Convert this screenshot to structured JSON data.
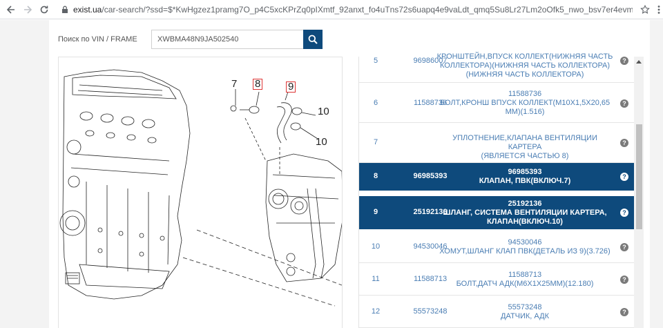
{
  "browser": {
    "url_host": "exist.ua",
    "url_path": "/car-search/?ssd=$*KwHgzez1pramg7O_p4C5xcKPrZq0pIXmtf_92anxt_fo4uTns72s6uapq4e9vaLdt_qmq5Su8Lr27Lm2oOfk5_nwo_bsv7er4evm7eH_9qKpv7uB8amr..."
  },
  "search": {
    "label": "Поиск по VIN / FRAME",
    "value": "XWBMA48N9JA502540"
  },
  "diagram": {
    "callouts": [
      "7",
      "8",
      "9",
      "10",
      "10"
    ]
  },
  "parts": [
    {
      "num": "5",
      "code": "96986007",
      "desc": [
        "КРОНШТЕЙН,ВПУСК КОЛЛЕКТ(НИЖНЯЯ ЧАСТЬ",
        "КОЛЛЕКТОРА)(НИЖНЯЯ ЧАСТЬ КОЛЛЕКТОРА)",
        "(НИЖНЯЯ ЧАСТЬ КОЛЛЕКТОРА)"
      ],
      "selected": false
    },
    {
      "num": "6",
      "code": "11588736",
      "desc": [
        "11588736",
        "БОЛТ,КРОНШ ВПУСК КОЛЛЕКТ(М10Х1,5Х20,65",
        "ММ)(1.516)"
      ],
      "selected": false
    },
    {
      "num": "7",
      "code": "",
      "desc": [
        "УПЛОТНЕНИЕ,КЛАПАНА ВЕНТИЛЯЦИИ КАРТЕРА",
        "(ЯВЛЯЕТСЯ ЧАСТЬЮ 8)"
      ],
      "selected": false
    },
    {
      "num": "8",
      "code": "96985393",
      "desc": [
        "96985393",
        "КЛАПАН, ПВК(ВКЛЮЧ.7)"
      ],
      "selected": true
    },
    {
      "num": "9",
      "code": "25192136",
      "desc": [
        "25192136",
        "ШЛАНГ, СИСТЕМА ВЕНТИЛЯЦИИ КАРТЕРА,",
        "КЛАПАН(ВКЛЮЧ.10)"
      ],
      "selected": true
    },
    {
      "num": "10",
      "code": "94530046",
      "desc": [
        "94530046",
        "ХОМУТ,ШЛАНГ КЛАП ПВК(ДЕТАЛЬ ИЗ 9)(3.726)"
      ],
      "selected": false
    },
    {
      "num": "11",
      "code": "11588713",
      "desc": [
        "11588713",
        "БОЛТ,ДАТЧ АДК(М6Х1Х25ММ)(12.180)"
      ],
      "selected": false
    },
    {
      "num": "12",
      "code": "55573248",
      "desc": [
        "55573248",
        "ДАТЧИК, АДК"
      ],
      "selected": false
    }
  ],
  "help_glyph": "?",
  "colors": {
    "accent": "#0e4a7c",
    "link": "#4a7db3"
  }
}
